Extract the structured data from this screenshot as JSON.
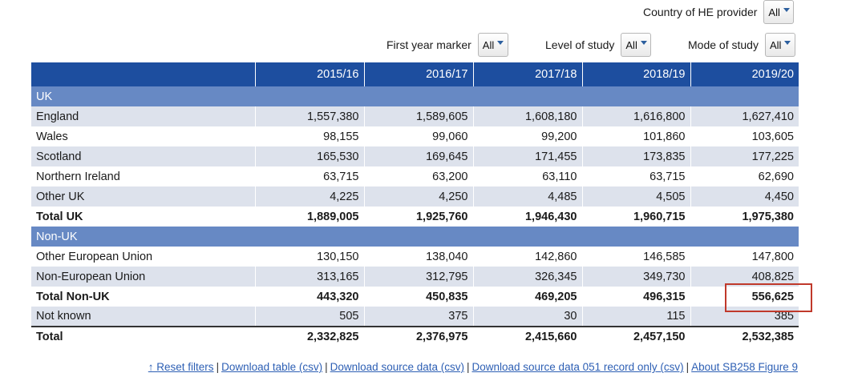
{
  "filters": {
    "country": {
      "label": "Country of HE provider",
      "value": "All"
    },
    "first_year": {
      "label": "First year marker",
      "value": "All"
    },
    "level": {
      "label": "Level of study",
      "value": "All"
    },
    "mode": {
      "label": "Mode of study",
      "value": "All"
    }
  },
  "table": {
    "columns": [
      "",
      "2015/16",
      "2016/17",
      "2017/18",
      "2018/19",
      "2019/20"
    ],
    "groups": {
      "uk": "UK",
      "non_uk": "Non-UK"
    },
    "rows": [
      {
        "label": "England",
        "values": [
          "1,557,380",
          "1,589,605",
          "1,608,180",
          "1,616,800",
          "1,627,410"
        ]
      },
      {
        "label": "Wales",
        "values": [
          "98,155",
          "99,060",
          "99,200",
          "101,860",
          "103,605"
        ]
      },
      {
        "label": "Scotland",
        "values": [
          "165,530",
          "169,645",
          "171,455",
          "173,835",
          "177,225"
        ]
      },
      {
        "label": "Northern Ireland",
        "values": [
          "63,715",
          "63,200",
          "63,110",
          "63,715",
          "62,690"
        ]
      },
      {
        "label": "Other UK",
        "values": [
          "4,225",
          "4,250",
          "4,485",
          "4,505",
          "4,450"
        ]
      },
      {
        "label": "Total UK",
        "values": [
          "1,889,005",
          "1,925,760",
          "1,946,430",
          "1,960,715",
          "1,975,380"
        ]
      },
      {
        "label": "Other European Union",
        "values": [
          "130,150",
          "138,040",
          "142,860",
          "146,585",
          "147,800"
        ]
      },
      {
        "label": "Non-European Union",
        "values": [
          "313,165",
          "312,795",
          "326,345",
          "349,730",
          "408,825"
        ]
      },
      {
        "label": "Total Non-UK",
        "values": [
          "443,320",
          "450,835",
          "469,205",
          "496,315",
          "556,625"
        ]
      },
      {
        "label": "Not known",
        "values": [
          "505",
          "375",
          "30",
          "115",
          "385"
        ]
      },
      {
        "label": "Total",
        "values": [
          "2,332,825",
          "2,376,975",
          "2,415,660",
          "2,457,150",
          "2,532,385"
        ]
      }
    ]
  },
  "links": {
    "reset": "↑ Reset filters",
    "download_table": "Download table (csv)",
    "download_source": "Download source data (csv)",
    "download_051": "Download source data 051 record only (csv)",
    "about": "About SB258 Figure 9",
    "separator": "|"
  },
  "colors": {
    "header": "#1d4e9f",
    "group": "#6789c4",
    "shade": "#dde2ec",
    "highlight": "#c0392b",
    "link": "#2d5fb4"
  }
}
